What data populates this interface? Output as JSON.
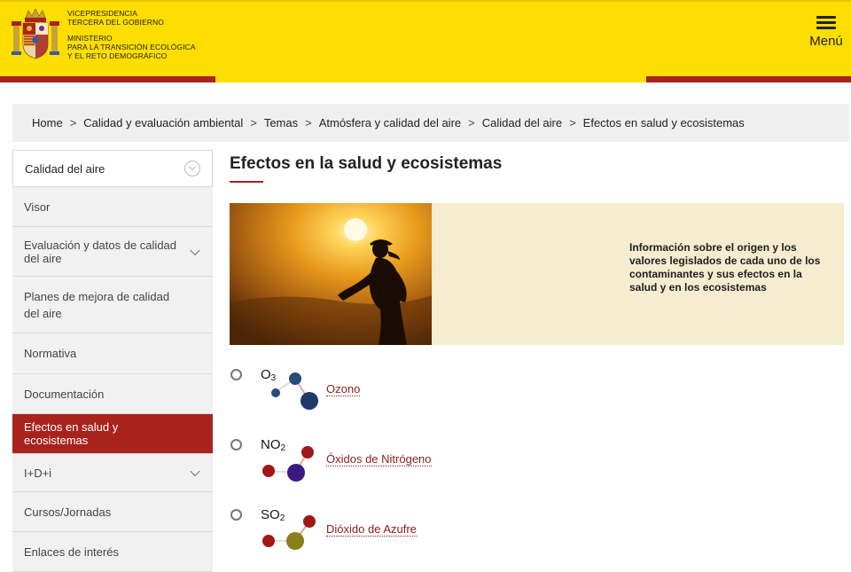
{
  "header": {
    "line1": "Vicepresidencia",
    "line2": "Tercera del Gobierno",
    "line3": "Ministerio",
    "line4": "para la Transición Ecológica",
    "line5": "y el Reto Demográfico",
    "menu_label": "Menú",
    "colors": {
      "yellow": "#fedd00",
      "red": "#a8231c"
    }
  },
  "breadcrumb": [
    "Home",
    "Calidad y evaluación ambiental",
    "Temas",
    "Atmósfera y calidad del aire",
    "Calidad del aire",
    "Efectos en salud y ecosistemas"
  ],
  "sidebar": {
    "items": [
      {
        "label": "Calidad del aire"
      },
      {
        "label": "Visor"
      },
      {
        "label": "Evaluación y datos de calidad del aire"
      },
      {
        "label": "Planes de mejora de calidad del aire"
      },
      {
        "label": "Normativa"
      },
      {
        "label": "Documentación"
      },
      {
        "label": "Efectos en salud y ecosistemas"
      },
      {
        "label": "I+D+i"
      },
      {
        "label": "Cursos/Jornadas"
      },
      {
        "label": "Enlaces de interés"
      }
    ]
  },
  "main": {
    "title": "Efectos en la salud y ecosistemas",
    "banner_text": "Información sobre el origen y los valores legislados de cada uno de los contaminantes y sus efectos en la salud y en los ecosistemas",
    "pollutants": [
      {
        "formula_base": "O",
        "formula_sub": "3",
        "link": "Ozono"
      },
      {
        "formula_base": "NO",
        "formula_sub": "2",
        "link": "Óxidos de Nitrógeno"
      },
      {
        "formula_base": "SO",
        "formula_sub": "2",
        "link": "Dióxido de Azufre"
      }
    ]
  }
}
